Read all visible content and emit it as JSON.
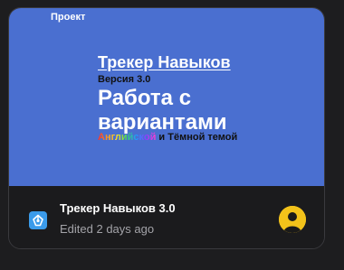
{
  "card": {
    "section_label": "Проект",
    "thumbnail": {
      "title": "Трекер Навыков",
      "version": "Версия 3.0",
      "heading": "Работа с вариантами",
      "subtitle_highlight": "Английской",
      "subtitle_rest": " и Тёмной темой"
    },
    "file": {
      "name": "Трекер Навыков 3.0",
      "meta": "Edited 2 days ago",
      "app_icon": "figma-file-icon",
      "avatar": "user-avatar"
    }
  },
  "colors": {
    "thumbnail_bg": "#4a6fd0",
    "card_bg": "#1b1b1d",
    "app_icon_bg": "#3b9bea",
    "avatar_bg": "#f2c21a"
  }
}
